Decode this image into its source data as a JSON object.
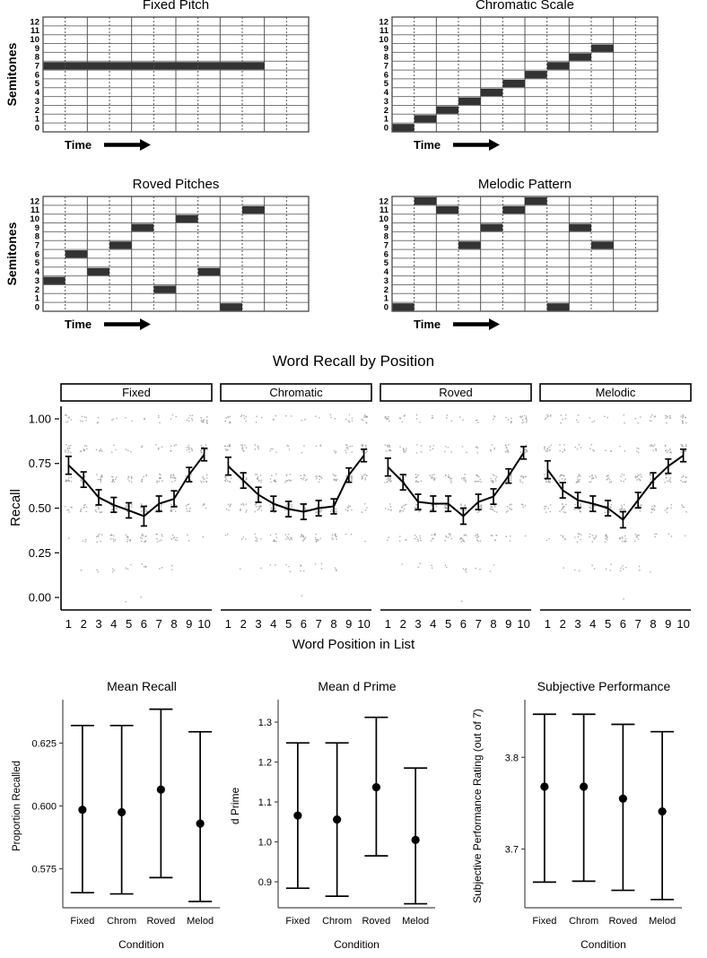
{
  "figure": {
    "title": "Word Recall by Position"
  },
  "pitch_panels": {
    "y_axis_label": "Semitones",
    "x_axis_label": "Time",
    "semitone_ticks": [
      "12",
      "11",
      "10",
      "9",
      "8",
      "7",
      "6",
      "5",
      "4",
      "3",
      "2",
      "1",
      "0"
    ],
    "panels": [
      {
        "title": "Fixed Pitch",
        "semitones": [
          7,
          7,
          7,
          7,
          7,
          7,
          7,
          7,
          7,
          7
        ]
      },
      {
        "title": "Chromatic Scale",
        "semitones": [
          0,
          1,
          2,
          3,
          4,
          5,
          6,
          7,
          8,
          9
        ]
      },
      {
        "title": "Roved Pitches",
        "semitones": [
          3,
          6,
          4,
          7,
          9,
          2,
          10,
          4,
          0,
          11
        ]
      },
      {
        "title": "Melodic Pattern",
        "semitones": [
          0,
          12,
          11,
          7,
          9,
          11,
          12,
          0,
          9,
          7
        ]
      }
    ]
  },
  "chart_data": [
    {
      "id": "word-recall-by-position",
      "type": "line",
      "title": "Word Recall by Position",
      "xlabel": "Word Position in List",
      "ylabel": "Recall",
      "x": [
        1,
        2,
        3,
        4,
        5,
        6,
        7,
        8,
        9,
        10
      ],
      "xtick_labels": [
        "1",
        "2",
        "3",
        "4",
        "5",
        "6",
        "7",
        "8",
        "9",
        "10"
      ],
      "ytick_labels": [
        "0.00",
        "0.25",
        "0.50",
        "0.75",
        "1.00"
      ],
      "ytick_values": [
        0.0,
        0.25,
        0.5,
        0.75,
        1.0
      ],
      "ylim": [
        -0.06,
        1.06
      ],
      "grid": false,
      "facets": [
        "Fixed",
        "Chromatic",
        "Roved",
        "Melodic"
      ],
      "series": [
        {
          "name": "Fixed",
          "values": [
            0.74,
            0.66,
            0.56,
            0.518,
            0.487,
            0.455,
            0.525,
            0.552,
            0.688,
            0.8
          ],
          "err_low": [
            0.69,
            0.617,
            0.518,
            0.477,
            0.445,
            0.4,
            0.482,
            0.508,
            0.648,
            0.765
          ],
          "err_high": [
            0.79,
            0.703,
            0.603,
            0.56,
            0.53,
            0.51,
            0.568,
            0.597,
            0.728,
            0.835
          ]
        },
        {
          "name": "Chromatic",
          "values": [
            0.735,
            0.655,
            0.575,
            0.525,
            0.495,
            0.48,
            0.5,
            0.51,
            0.685,
            0.795
          ],
          "err_low": [
            0.685,
            0.612,
            0.533,
            0.483,
            0.452,
            0.437,
            0.457,
            0.468,
            0.645,
            0.76
          ],
          "err_high": [
            0.785,
            0.698,
            0.617,
            0.567,
            0.538,
            0.523,
            0.543,
            0.552,
            0.725,
            0.83
          ]
        },
        {
          "name": "Roved",
          "values": [
            0.73,
            0.645,
            0.535,
            0.525,
            0.525,
            0.455,
            0.535,
            0.565,
            0.68,
            0.81
          ],
          "err_low": [
            0.68,
            0.602,
            0.492,
            0.482,
            0.482,
            0.41,
            0.492,
            0.522,
            0.64,
            0.775
          ],
          "err_high": [
            0.78,
            0.688,
            0.578,
            0.568,
            0.568,
            0.5,
            0.578,
            0.608,
            0.72,
            0.845
          ]
        },
        {
          "name": "Melodic",
          "values": [
            0.715,
            0.6,
            0.545,
            0.525,
            0.5,
            0.435,
            0.545,
            0.655,
            0.735,
            0.795
          ],
          "err_low": [
            0.665,
            0.557,
            0.502,
            0.482,
            0.457,
            0.39,
            0.502,
            0.612,
            0.695,
            0.76
          ],
          "err_high": [
            0.765,
            0.643,
            0.588,
            0.568,
            0.543,
            0.48,
            0.588,
            0.698,
            0.775,
            0.83
          ]
        }
      ]
    },
    {
      "id": "mean-recall",
      "type": "scatter",
      "title": "Mean Recall",
      "xlabel": "Condition",
      "ylabel": "Proportion Recalled",
      "categories": [
        "Fixed",
        "Chrom",
        "Roved",
        "Melod"
      ],
      "ytick_labels": [
        "0.575",
        "0.600",
        "0.625"
      ],
      "ytick_values": [
        0.575,
        0.6,
        0.625
      ],
      "ylim": [
        0.5595,
        0.6405
      ],
      "values": [
        0.5985,
        0.5975,
        0.6065,
        0.593
      ],
      "err_low": [
        0.5655,
        0.565,
        0.5715,
        0.562
      ],
      "err_high": [
        0.632,
        0.632,
        0.6385,
        0.6295
      ]
    },
    {
      "id": "mean-d-prime",
      "type": "scatter",
      "title": "Mean d Prime",
      "xlabel": "Condition",
      "ylabel": "d Prime",
      "categories": [
        "Fixed",
        "Chrom",
        "Roved",
        "Melod"
      ],
      "ytick_labels": [
        "0.9",
        "1.0",
        "1.1",
        "1.2",
        "1.3"
      ],
      "ytick_values": [
        0.9,
        1.0,
        1.1,
        1.2,
        1.3
      ],
      "ylim": [
        0.835,
        1.345
      ],
      "values": [
        1.066,
        1.056,
        1.137,
        1.005
      ],
      "err_low": [
        0.884,
        0.864,
        0.965,
        0.845
      ],
      "err_high": [
        1.248,
        1.248,
        1.312,
        1.185
      ]
    },
    {
      "id": "subjective-performance",
      "type": "scatter",
      "title": "Subjective Performance",
      "xlabel": "Condition",
      "ylabel": "Subjective Performance Rating (out of 7)",
      "categories": [
        "Fixed",
        "Chrom",
        "Roved",
        "Melod"
      ],
      "ytick_labels": [
        "3.7",
        "3.8"
      ],
      "ytick_values": [
        3.7,
        3.8
      ],
      "ylim": [
        3.636,
        3.858
      ],
      "values": [
        3.768,
        3.768,
        3.755,
        3.741
      ],
      "err_low": [
        3.664,
        3.665,
        3.655,
        3.645
      ],
      "err_high": [
        3.847,
        3.847,
        3.836,
        3.828
      ]
    }
  ],
  "colors": {
    "bar_fill": "#333333",
    "grid_line": "#777777",
    "axis": "#000000",
    "jitter_point": "#9a9a9a"
  }
}
